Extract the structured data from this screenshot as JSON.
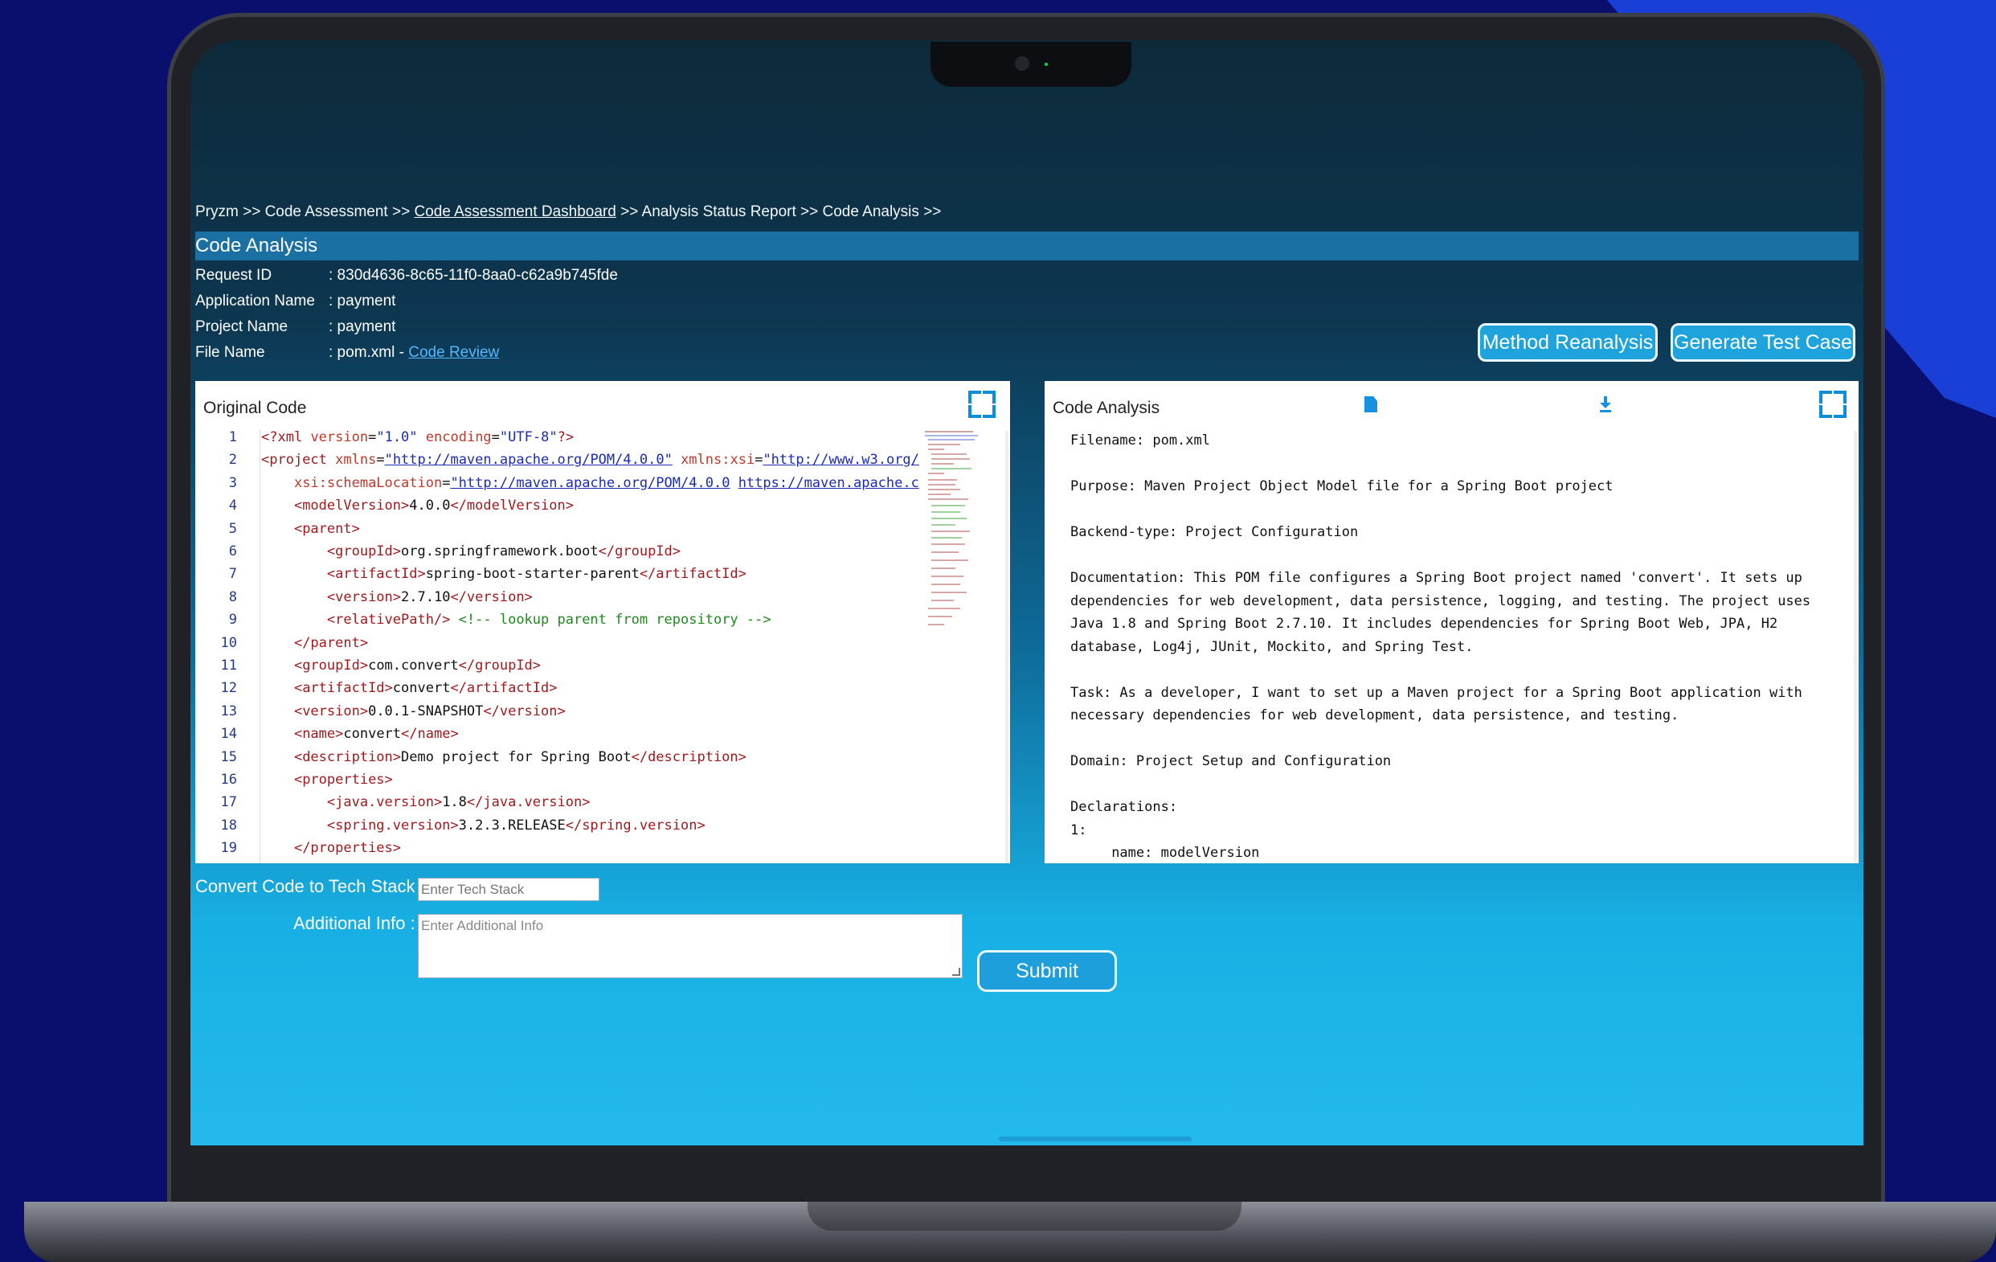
{
  "breadcrumb": {
    "p1": "Pryzm >> Code Assessment >> ",
    "link": "Code Assessment Dashboard",
    "p2": " >> Analysis Status Report >> Code Analysis >>"
  },
  "header": {
    "title": "Code Analysis"
  },
  "info": {
    "request_id_label": "Request ID",
    "request_id": ": 830d4636-8c65-11f0-8aa0-c62a9b745fde",
    "app_name_label": "Application Name",
    "app_name": ": payment",
    "project_name_label": "Project Name",
    "project_name": ": payment",
    "file_name_label": "File Name",
    "file_name": ": pom.xml",
    "separator": " - ",
    "code_review_link": "Code Review"
  },
  "buttons": {
    "method_reanalysis": "Method Reanalysis",
    "generate_test_case": "Generate Test Case",
    "submit": "Submit"
  },
  "original_code": {
    "title": "Original Code",
    "line_numbers": [
      "1",
      "2",
      "3",
      "4",
      "5",
      "6",
      "7",
      "8",
      "9",
      "10",
      "11",
      "12",
      "13",
      "14",
      "15",
      "16",
      "17",
      "18",
      "19"
    ]
  },
  "code_analysis": {
    "title": "Code Analysis",
    "text": "Filename: pom.xml\n\nPurpose: Maven Project Object Model file for a Spring Boot project\n\nBackend-type: Project Configuration\n\nDocumentation: This POM file configures a Spring Boot project named 'convert'. It sets up\ndependencies for web development, data persistence, logging, and testing. The project uses\nJava 1.8 and Spring Boot 2.7.10. It includes dependencies for Spring Boot Web, JPA, H2\ndatabase, Log4j, JUnit, Mockito, and Spring Test.\n\nTask: As a developer, I want to set up a Maven project for a Spring Boot application with\nnecessary dependencies for web development, data persistence, and testing.\n\nDomain: Project Setup and Configuration\n\nDeclarations:\n1:\n     name: modelVersion"
  },
  "form": {
    "tech_stack_label": "Convert Code to Tech Stack :",
    "tech_stack_placeholder": "Enter Tech Stack",
    "additional_info_label": "Additional Info :",
    "additional_info_placeholder": "Enter Additional Info"
  },
  "colors": {
    "accent": "#1ea3dd",
    "title_bar": "#1a6fa3",
    "link": "#53b8ff"
  }
}
